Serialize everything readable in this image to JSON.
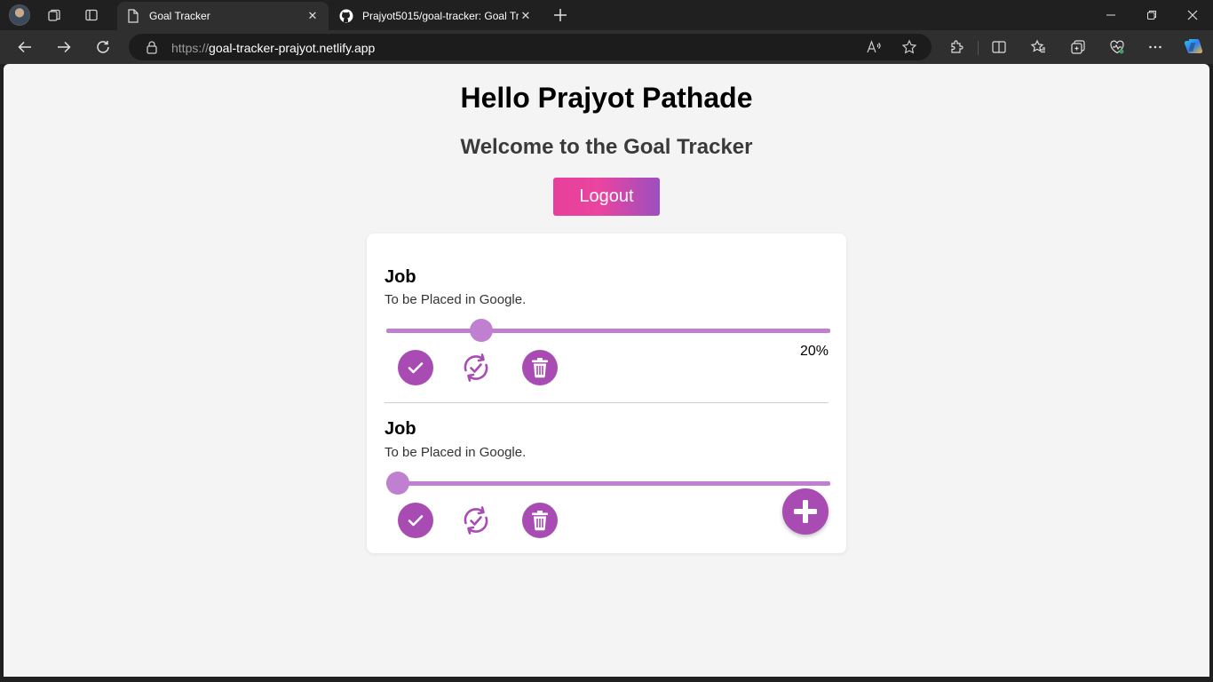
{
  "browser": {
    "tabs": [
      {
        "title": "Goal Tracker",
        "active": true,
        "favicon": "page-icon"
      },
      {
        "title": "Prajyot5015/goal-tracker: Goal Tr",
        "active": false,
        "favicon": "github-icon"
      }
    ],
    "url_scheme": "https://",
    "url_host": "goal-tracker-prajyot.netlify.app"
  },
  "page": {
    "greeting": "Hello Prajyot Pathade",
    "welcome": "Welcome to the Goal Tracker",
    "logout_label": "Logout"
  },
  "goals": [
    {
      "title": "Job",
      "description": "To be Placed in Google.",
      "progress": 20,
      "percent_label": "20%"
    },
    {
      "title": "Job",
      "description": "To be Placed in Google.",
      "progress": 0,
      "percent_label": ""
    }
  ],
  "colors": {
    "accent": "#a84bb3",
    "slider": "#c07fd0",
    "logout_gradient_start": "#e8409a",
    "logout_gradient_end": "#9b4fc0"
  }
}
